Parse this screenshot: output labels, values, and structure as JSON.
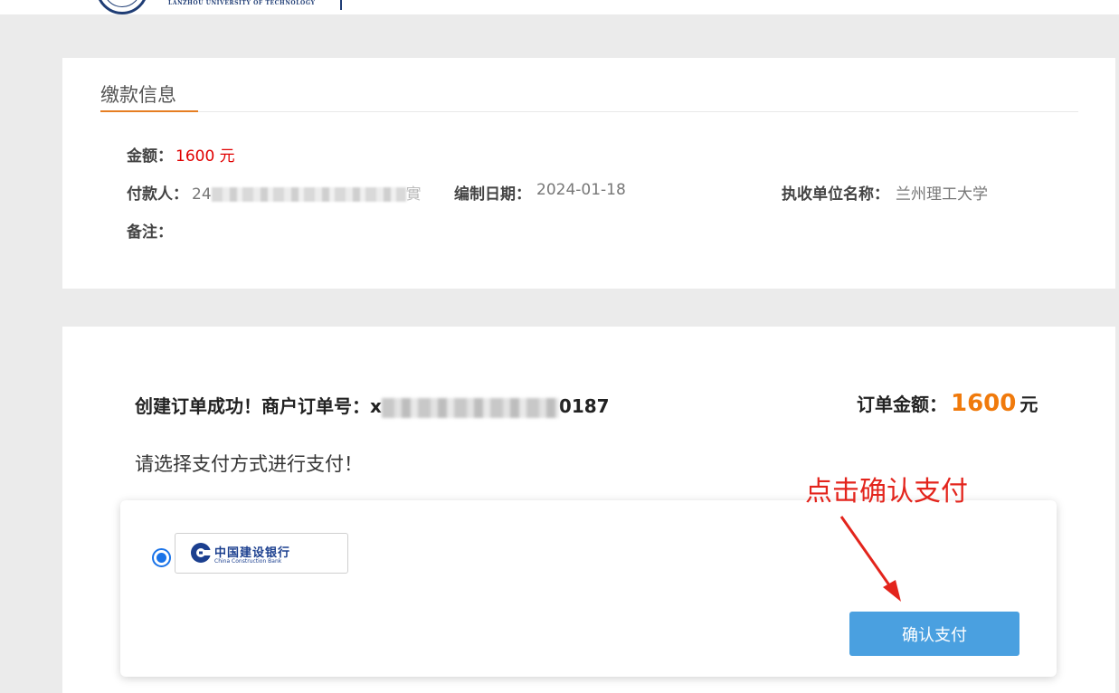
{
  "header": {
    "logo_text": "LANZHOU UNIVERSITY OF TECHNOLOGY"
  },
  "payment_info": {
    "title": "缴款信息",
    "amount_label": "金额：",
    "amount_value": "1600 元",
    "payer_label": "付款人：",
    "payer_value_prefix": "24",
    "payer_value_suffix": "實",
    "date_label": "编制日期：",
    "date_value": "2024-01-18",
    "unit_label": "执收单位名称：",
    "unit_value": "兰州理工大学",
    "remark_label": "备注："
  },
  "order": {
    "success_text": "创建订单成功！商户订单号：",
    "order_no_prefix": "x",
    "order_no_suffix": "0187",
    "amount_label": "订单金额：",
    "amount_value": "1600",
    "amount_unit": "元",
    "prompt": "请选择支付方式进行支付！"
  },
  "payment_method": {
    "bank_name": "中国建设银行",
    "bank_name_en": "China Construction Bank",
    "selected": true,
    "confirm_label": "确认支付"
  },
  "annotation": {
    "text": "点击确认支付"
  },
  "colors": {
    "accent_orange": "#e67e22",
    "amount_orange": "#f07a0c",
    "alert_red": "#e00000",
    "button_blue": "#4aa0e0",
    "bank_blue": "#1b3f8f"
  }
}
